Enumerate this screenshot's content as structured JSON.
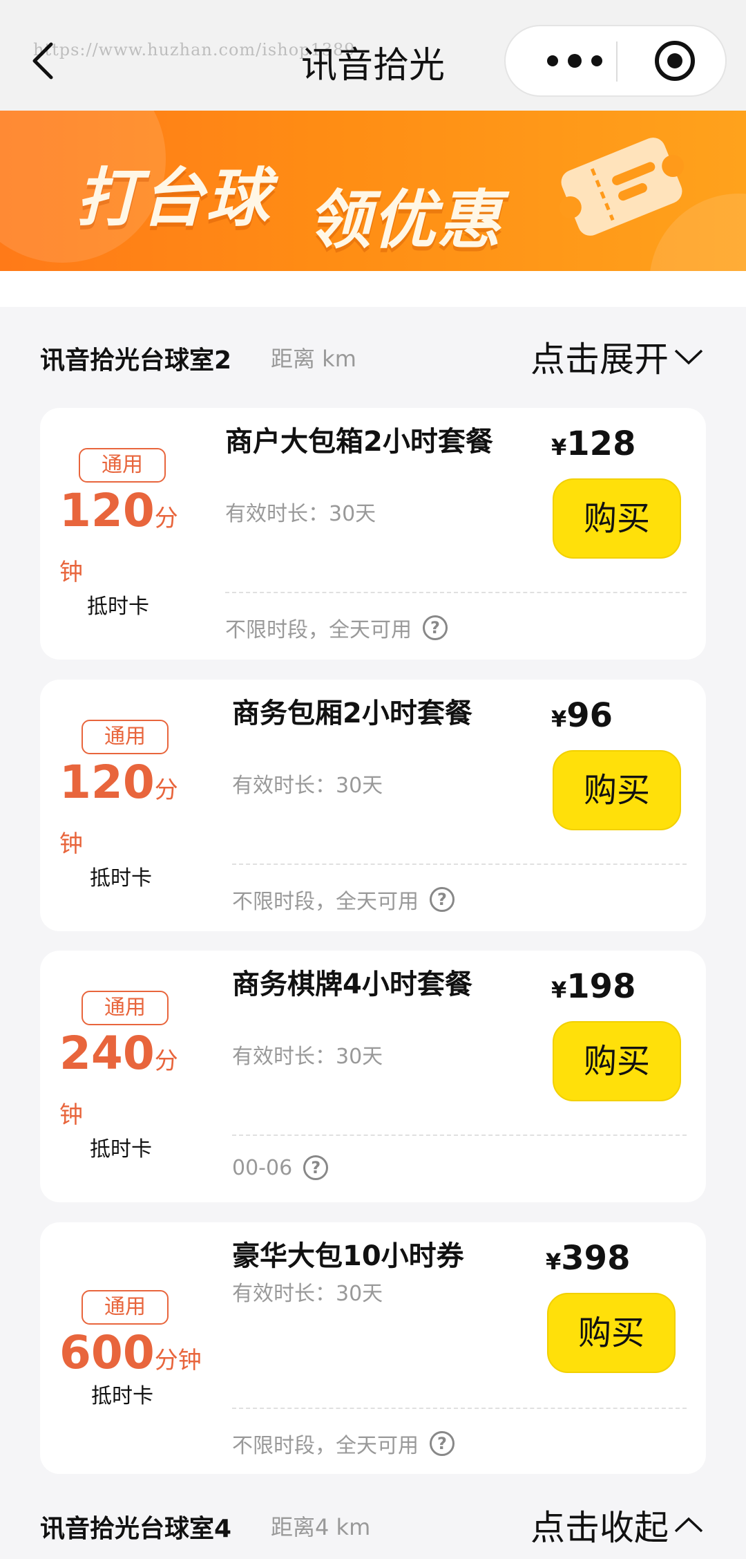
{
  "nav": {
    "title": "讯音拾光",
    "watermark": "https://www.huzhan.com/ishop1389"
  },
  "banner": {
    "text_left": "打台球",
    "text_right": "领优惠"
  },
  "sections": [
    {
      "store": "讯音拾光台球室2",
      "distance": "距离 km",
      "toggle": "点击展开"
    },
    {
      "store": "讯音拾光台球室4",
      "distance": "距离4 km",
      "toggle": "点击收起"
    }
  ],
  "products": [
    {
      "tag": "通用",
      "amount": "120",
      "unit_a": "分",
      "unit_b": "钟",
      "card_type": "抵时卡",
      "name": "商户大包箱2小时套餐",
      "validity": "有效时长：30天",
      "availability": "不限时段，全天可用",
      "currency": "¥",
      "price": "128",
      "buy": "购买"
    },
    {
      "tag": "通用",
      "amount": "120",
      "unit_a": "分",
      "unit_b": "钟",
      "card_type": "抵时卡",
      "name": "商务包厢2小时套餐",
      "validity": "有效时长：30天",
      "availability": "不限时段，全天可用",
      "currency": "¥",
      "price": "96",
      "buy": "购买"
    },
    {
      "tag": "通用",
      "amount": "240",
      "unit_a": "分",
      "unit_b": "钟",
      "card_type": "抵时卡",
      "name": "商务棋牌4小时套餐",
      "validity": "有效时长：30天",
      "availability": "00-06",
      "currency": "¥",
      "price": "198",
      "buy": "购买"
    },
    {
      "tag": "通用",
      "amount": "600",
      "unit_a": "分钟",
      "unit_b": "",
      "card_type": "抵时卡",
      "name": "豪华大包10小时券",
      "validity": "有效时长：30天",
      "availability": "不限时段，全天可用",
      "currency": "¥",
      "price": "398",
      "buy": "购买"
    }
  ],
  "colors": {
    "accent": "#e8653c",
    "buy_button": "#ffe00a",
    "banner": "#ff8d14"
  }
}
